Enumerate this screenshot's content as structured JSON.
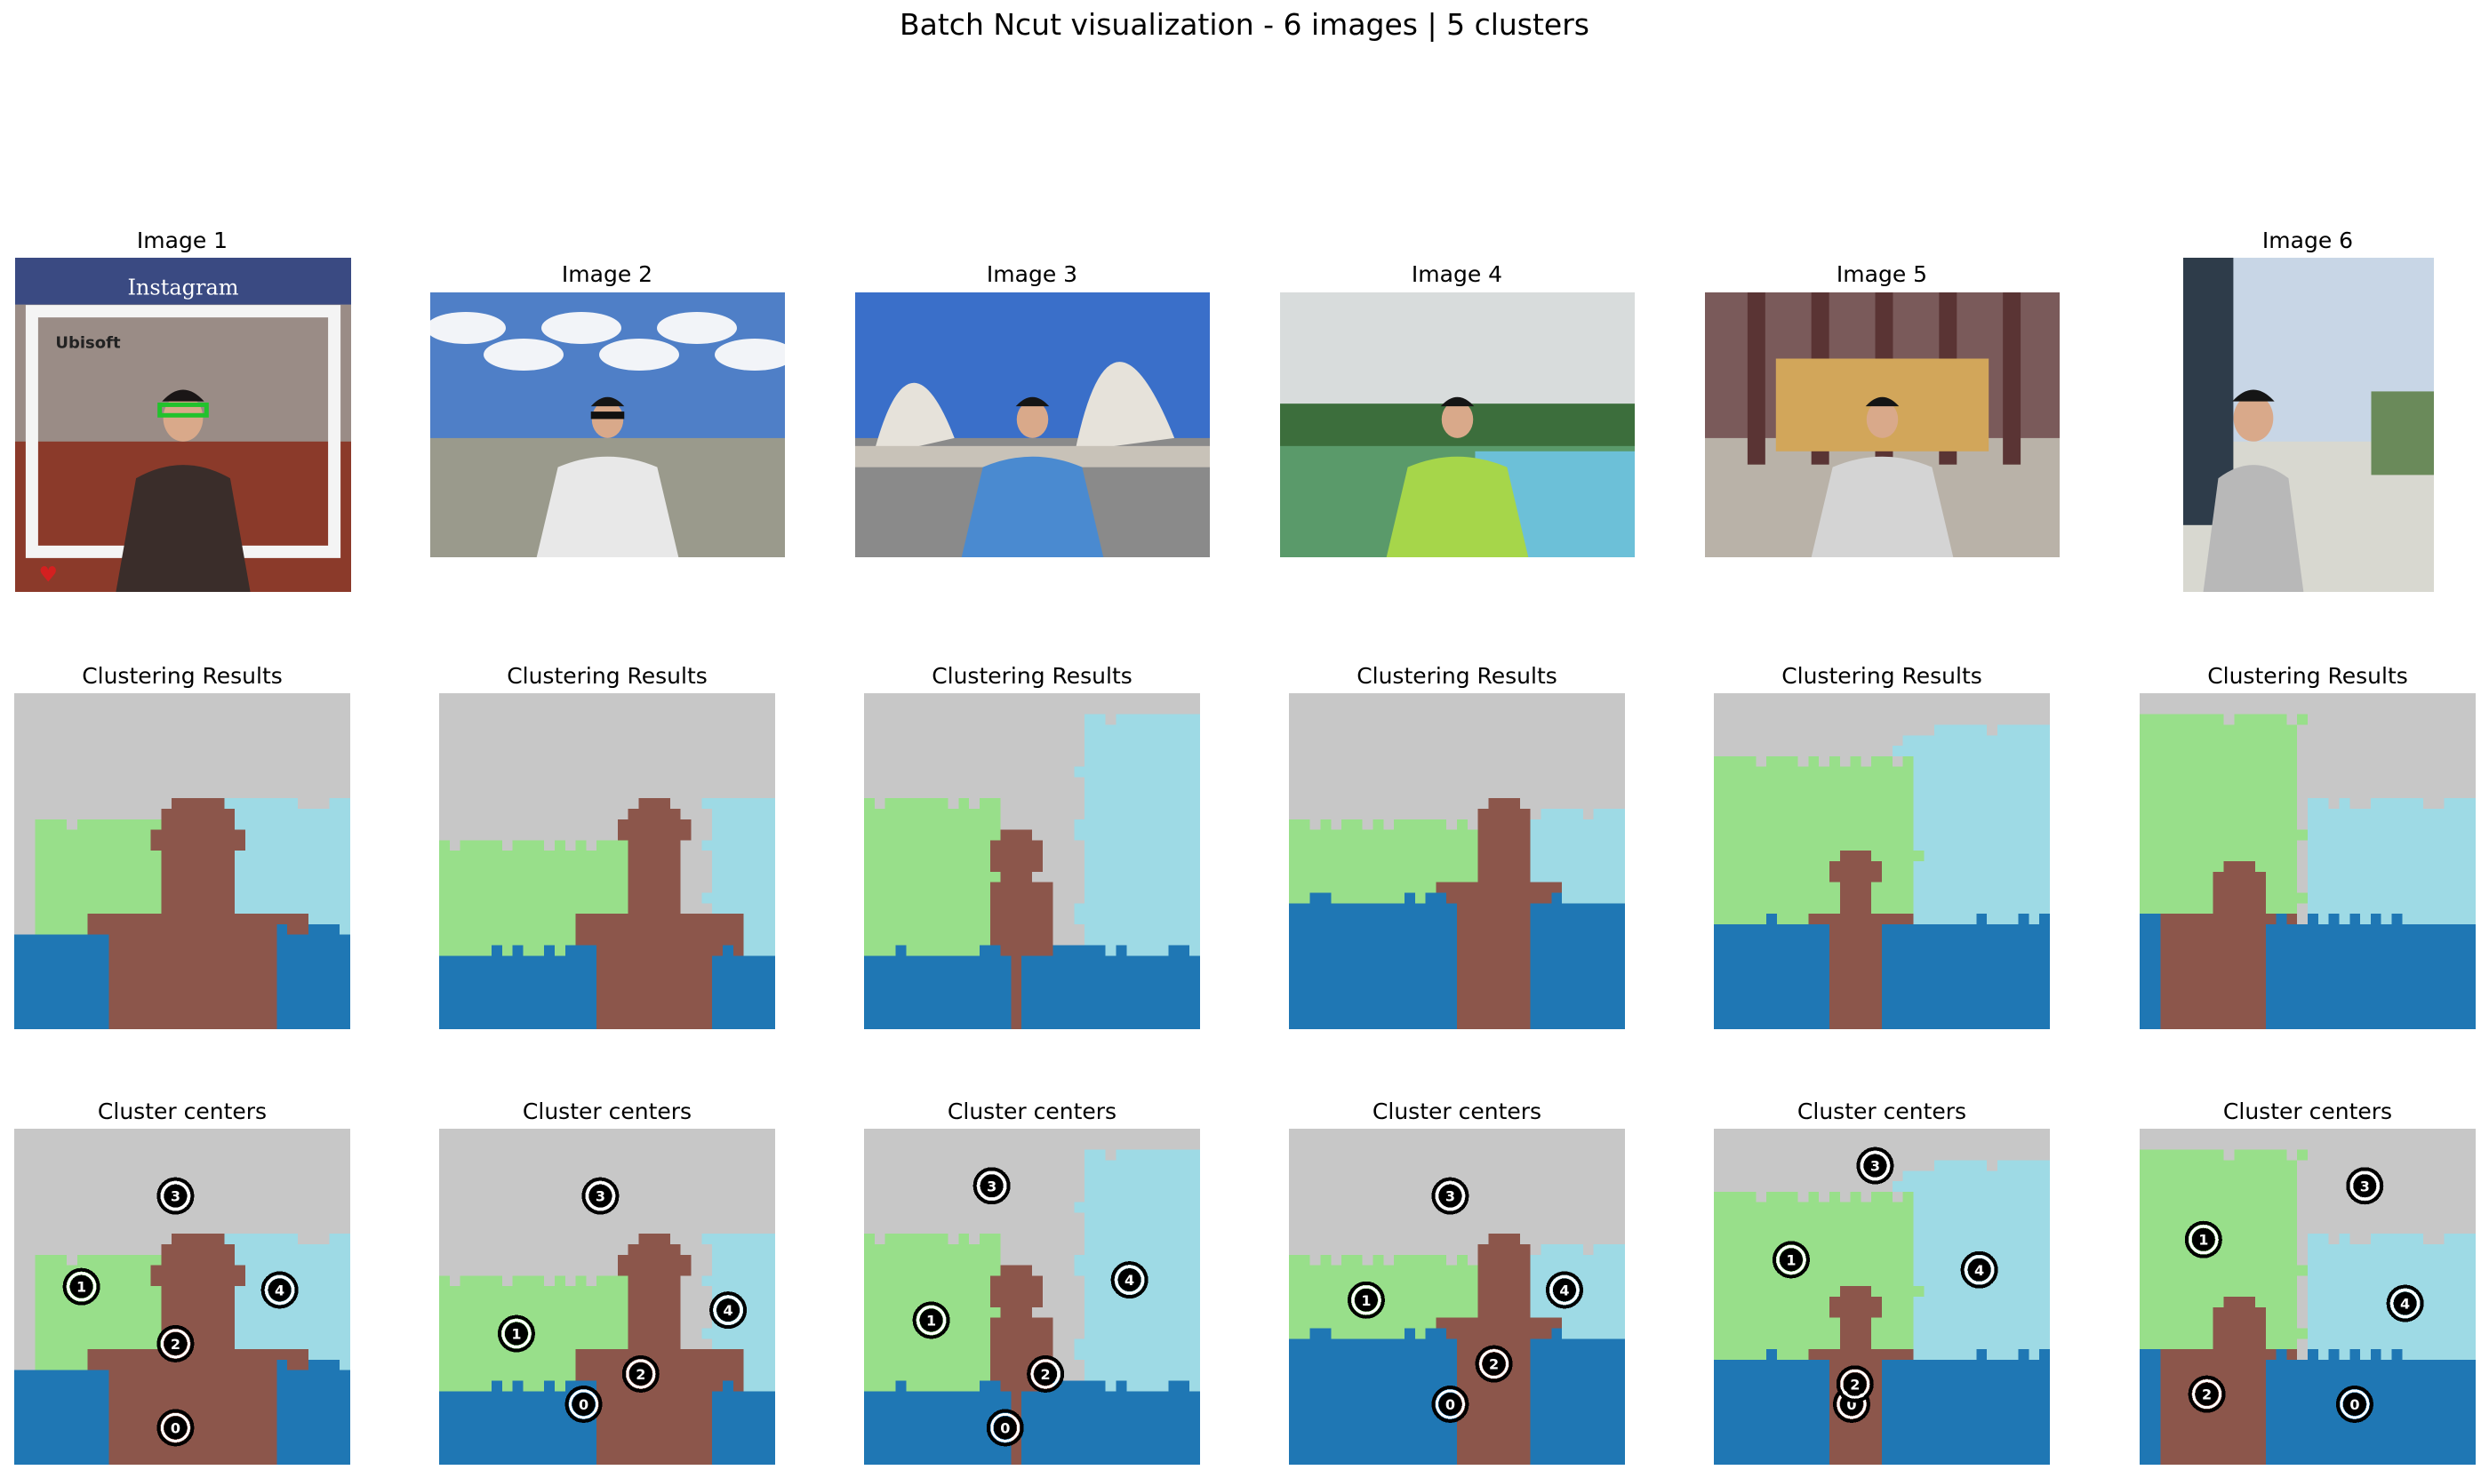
{
  "figure_title": "Batch Ncut visualization - 6 images | 5 clusters",
  "row_titles": {
    "clusters": "Clustering Results",
    "centers": "Cluster centers"
  },
  "palette": {
    "0": "#1f77b4",
    "1": "#98df8a",
    "2": "#8c564b",
    "3": "#c7c7c7",
    "4": "#9edae5"
  },
  "images": [
    {
      "title": "Image 1",
      "photo": {
        "description_icon": "instagram-frame-photo",
        "header_text": "Instagram",
        "brand_text": "Ubisoft",
        "sky": "#9a8c86",
        "ground": "#8b3a2a",
        "person": "#3a2d2a"
      },
      "centers": [
        0,
        1,
        2,
        3,
        4
      ]
    },
    {
      "title": "Image 2",
      "photo": {
        "description_icon": "racecourse-photo",
        "sky": "#4f7fc7",
        "ground": "#9a9a8c",
        "person": "#e8e8e8"
      },
      "centers": [
        0,
        1,
        2,
        3,
        4
      ]
    },
    {
      "title": "Image 3",
      "photo": {
        "description_icon": "opera-house-photo",
        "sky": "#3a6fc9",
        "ground": "#8a8a8a",
        "person": "#4a8ad0"
      },
      "centers": [
        0,
        1,
        2,
        3,
        4
      ]
    },
    {
      "title": "Image 4",
      "photo": {
        "description_icon": "lake-photo",
        "sky": "#d8dcdc",
        "ground": "#5a9a6a",
        "person": "#a6d64a"
      },
      "centers": [
        0,
        1,
        2,
        3,
        4
      ]
    },
    {
      "title": "Image 5",
      "photo": {
        "description_icon": "building-entrance-photo",
        "sky": "#7a5a5a",
        "ground": "#b9b2a8",
        "person": "#d4d4d4"
      },
      "centers": [
        0,
        1,
        2,
        3,
        4
      ]
    },
    {
      "title": "Image 6",
      "photo": {
        "description_icon": "sidewalk-photo",
        "sky": "#c8d6e6",
        "ground": "#d8d8d0",
        "person": "#b8b8b8"
      },
      "centers": [
        0,
        1,
        2,
        3,
        4
      ]
    }
  ]
}
